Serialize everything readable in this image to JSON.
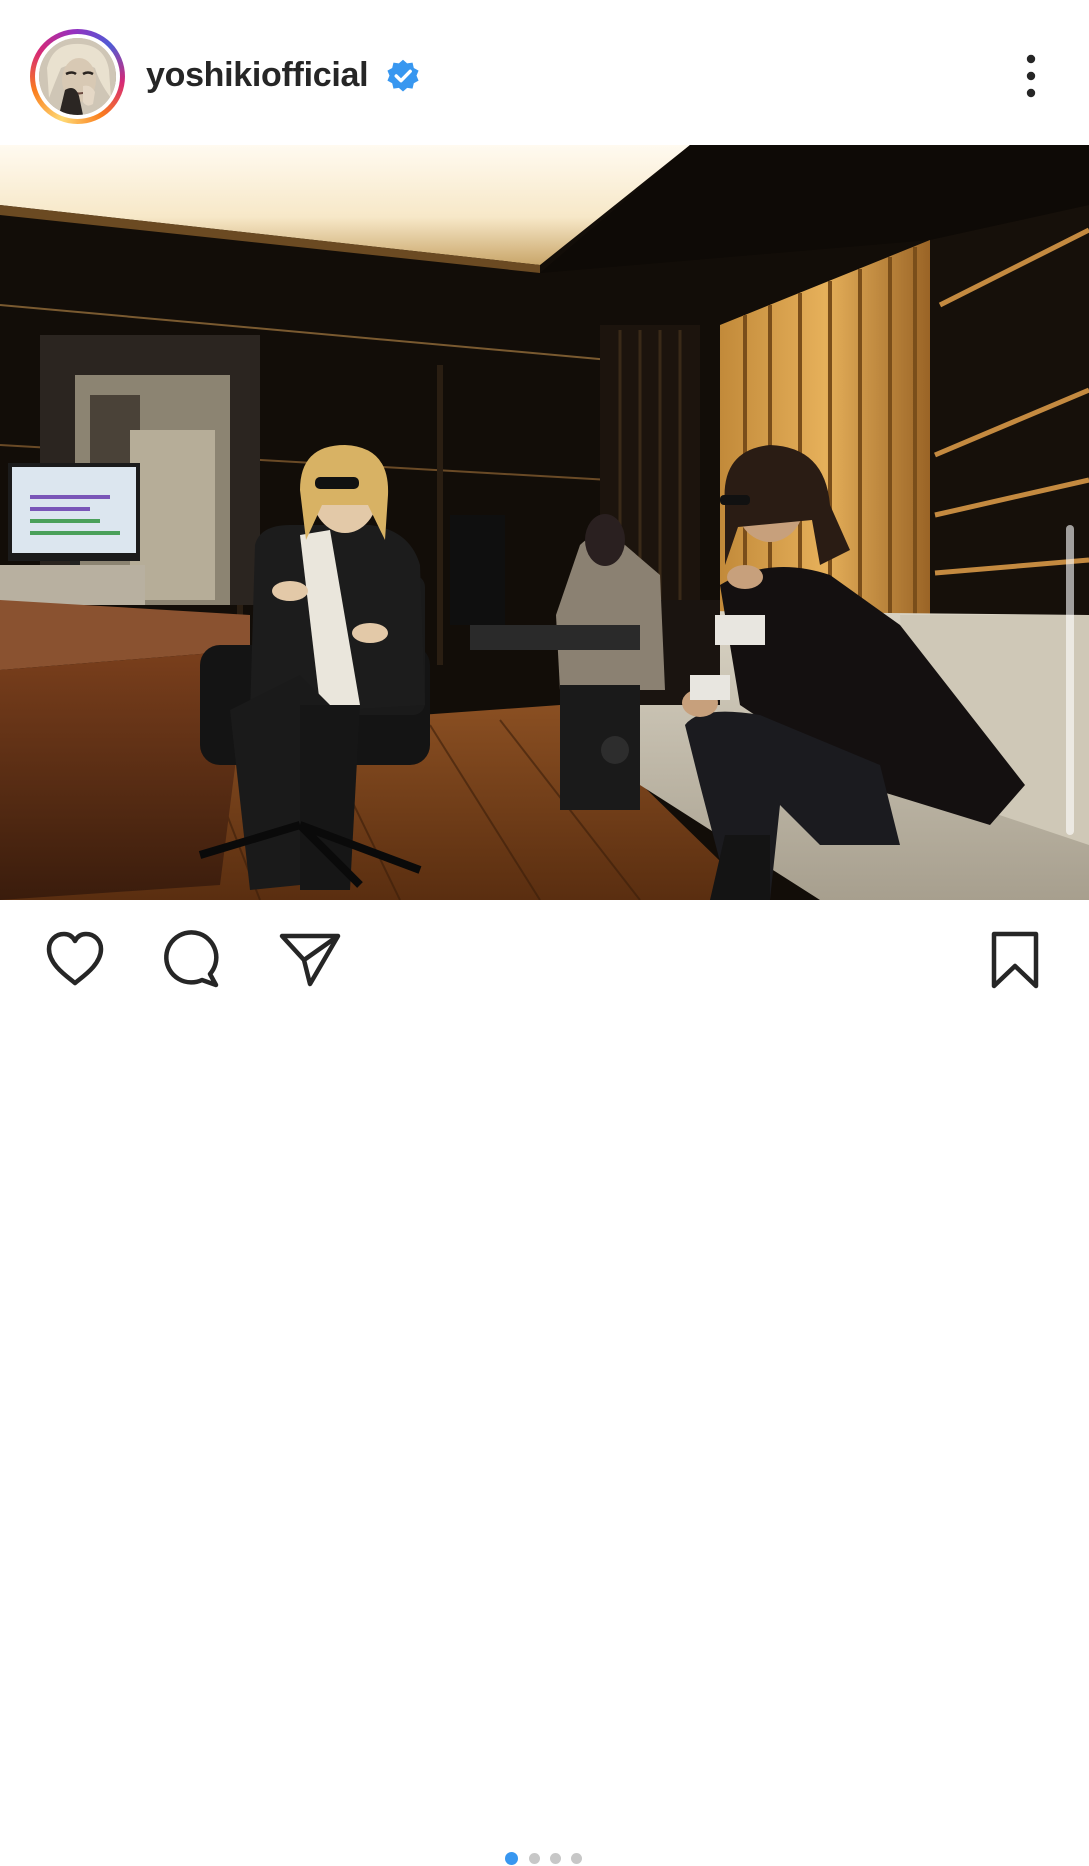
{
  "post": {
    "username": "yoshikiofficial",
    "verified": true,
    "carousel": {
      "total": 4,
      "active": 1
    }
  },
  "icons": {
    "verified": "verified-badge-icon",
    "more": "more-options-icon",
    "like": "heart-icon",
    "comment": "comment-icon",
    "share": "paper-plane-icon",
    "save": "bookmark-icon"
  },
  "colors": {
    "verified": "#3897f0",
    "text": "#262626",
    "dot_active": "#3897f0",
    "dot_inactive": "#c7c7c7"
  }
}
